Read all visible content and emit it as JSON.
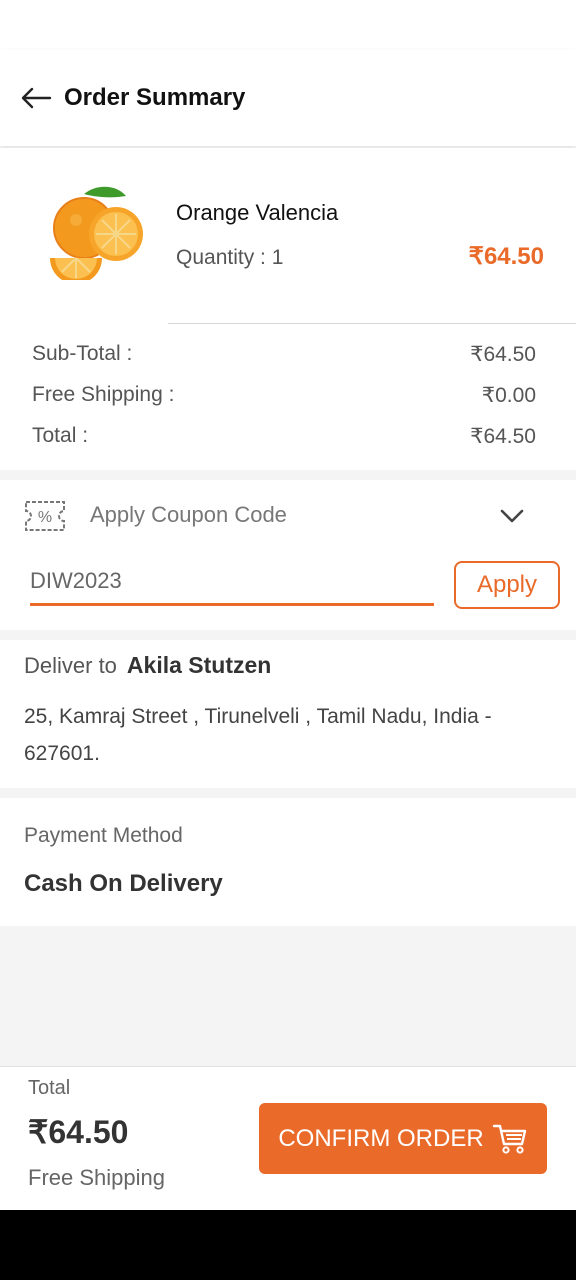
{
  "header": {
    "title": "Order Summary"
  },
  "product": {
    "name": "Orange Valencia",
    "quantity_text": "Quantity :  1",
    "price": "₹64.50"
  },
  "totals": {
    "subtotal_label": "Sub-Total :",
    "subtotal_value": "₹64.50",
    "shipping_label": "Free Shipping :",
    "shipping_value": "₹0.00",
    "total_label": "Total :",
    "total_value": "₹64.50"
  },
  "coupon": {
    "title": "Apply Coupon Code",
    "code_value": "DIW2023",
    "apply_label": "Apply"
  },
  "address": {
    "deliver_label": "Deliver to",
    "recipient": "Akila Stutzen",
    "line": "25, Kamraj Street , Tirunelveli , Tamil Nadu, India - 627601."
  },
  "payment": {
    "label": "Payment Method",
    "value": "Cash On Delivery"
  },
  "bottom": {
    "total_label": "Total",
    "total_value": "₹64.50",
    "shipping_label": "Free Shipping",
    "confirm_label": "CONFIRM ORDER"
  },
  "colors": {
    "accent": "#ea6a2a"
  }
}
